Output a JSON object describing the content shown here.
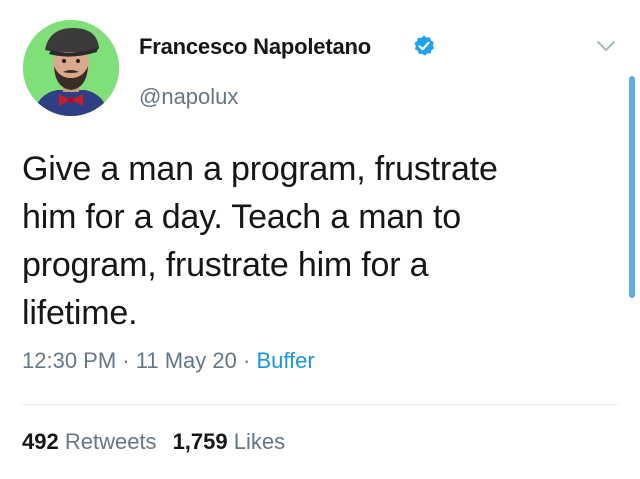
{
  "user": {
    "name": "Francesco Napoletano",
    "handle": "@napolux",
    "verified": true,
    "avatar_icon": "profile-photo"
  },
  "tweet": {
    "text": "Give a man a program, frustrate\nhim for a day. Teach a man to\nprogram, frustrate him for a\nlifetime.",
    "time": "12:30 PM",
    "separator": "·",
    "date": "11 May 20",
    "source": "Buffer"
  },
  "stats": {
    "retweets_count": "492",
    "retweets_label": "Retweets",
    "likes_count": "1,759",
    "likes_label": "Likes"
  },
  "colors": {
    "accent": "#1b95e0",
    "secondary_text": "#657786",
    "primary_text": "#14171a",
    "scrollbar": "#5aaee6"
  }
}
